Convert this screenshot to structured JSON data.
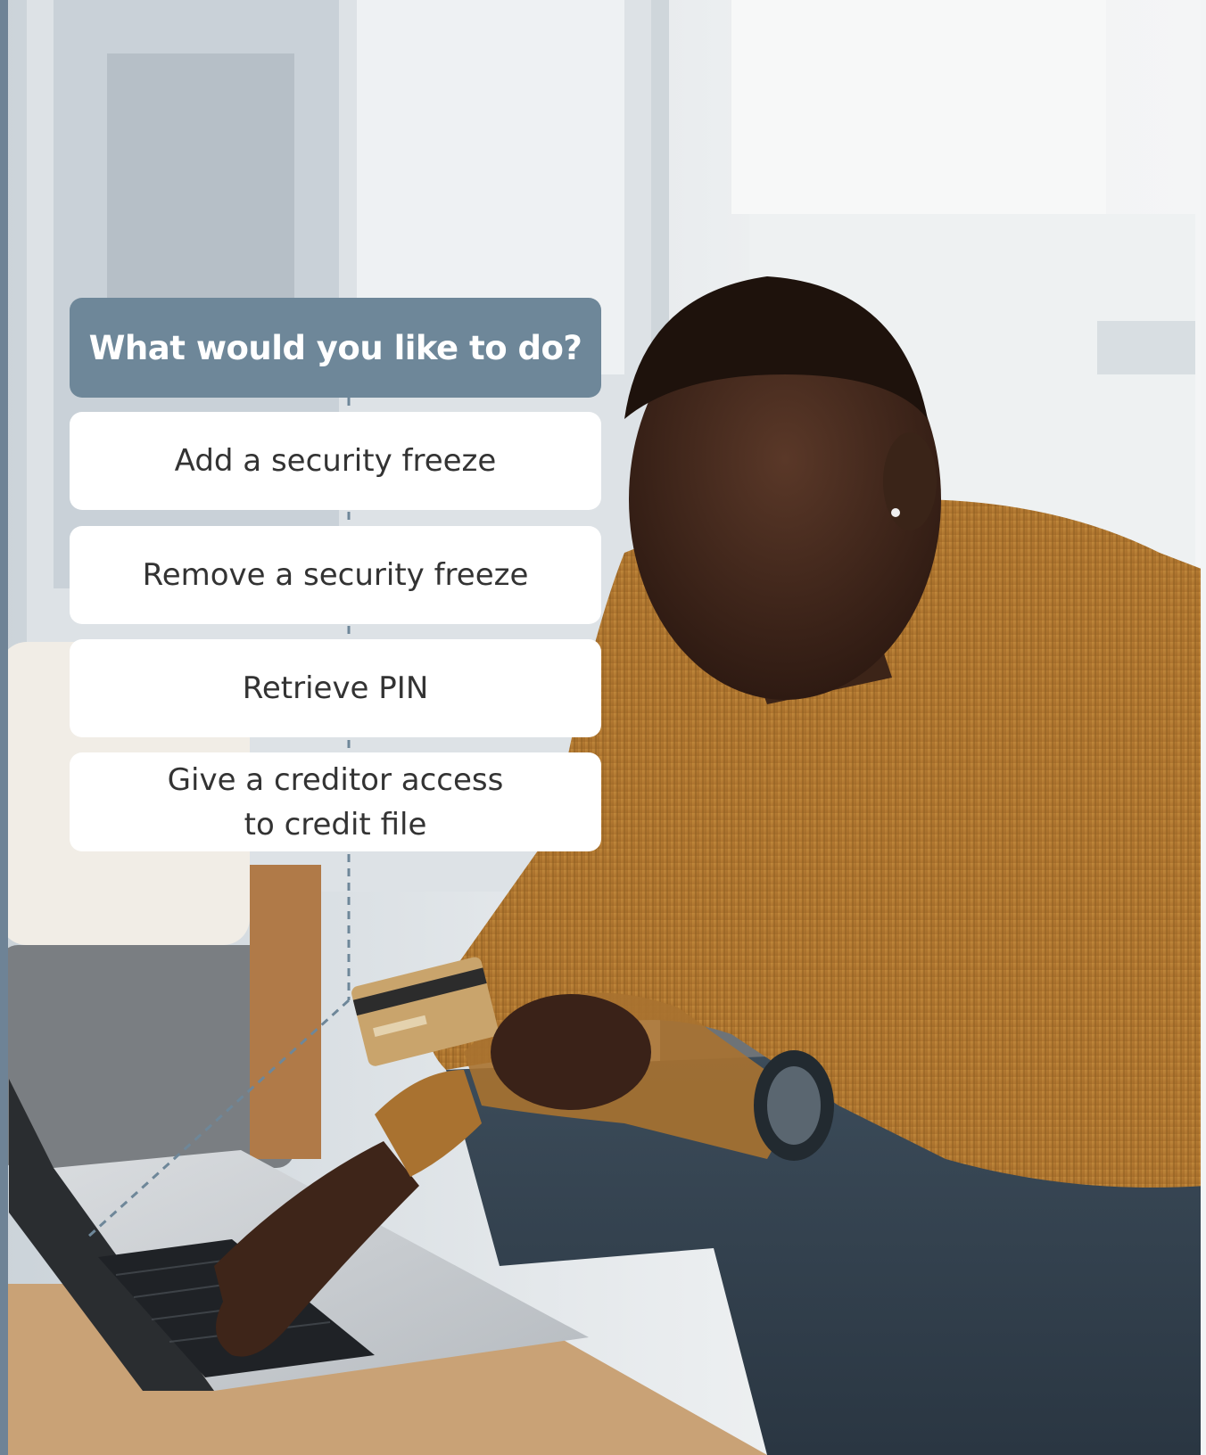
{
  "menu": {
    "title": "What would you like to do?",
    "options": [
      {
        "label": "Add a security freeze"
      },
      {
        "label": "Remove a security freeze"
      },
      {
        "label": "Retrieve PIN"
      },
      {
        "label": "Give a creditor access\nto credit file"
      }
    ]
  },
  "colors": {
    "header": "#6e8799",
    "option_bg": "#ffffff",
    "option_text": "#333333",
    "connector": "#6e8799",
    "sweater": "#b47a2e"
  }
}
